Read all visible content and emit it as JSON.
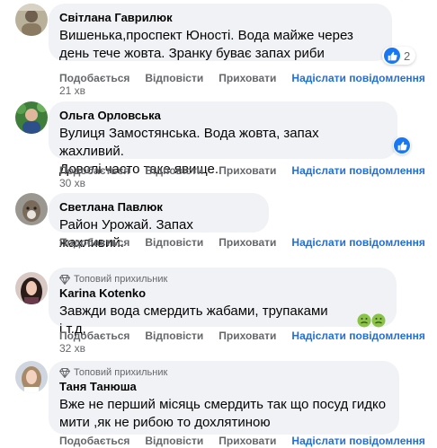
{
  "actions": {
    "like": "Подобається",
    "reply": "Відповісти",
    "hide": "Приховати",
    "send_message": "Надіслати повідомлення"
  },
  "comments": [
    {
      "author": "Світлана Гаврилюк",
      "text_lines": [
        "Вишенька,проспект Юності. Вода майже через",
        "день тече жовта. Зранку буває запах риби"
      ],
      "reactions": "2",
      "time": "21 хв"
    },
    {
      "author": "Ольга Орловська",
      "text_lines": [
        "Вулиця Замостянська. Вода жовта, запах жахливий.",
        "Доволі часто таке явище."
      ],
      "time": "30 хв"
    },
    {
      "author": "Светлана Павлюк",
      "text_lines": [
        "Район Урожай. Запах жахливий."
      ],
      "time": ""
    },
    {
      "badge": "Топовий прихильник",
      "author": "Karina Kotenko",
      "text_lines": [
        "Завжди вода смердить жабами, трупаками і.т.д,"
      ],
      "time": "32 хв"
    },
    {
      "badge": "Топовий прихильник",
      "author": "Таня Танюша",
      "text_lines": [
        "Вже не перший місяць смердить так що посуд гидко",
        "мити ,як не рибою то дохлятиною"
      ],
      "time": ""
    }
  ],
  "colors": {
    "bubble": "#f0f2f5",
    "link": "#216fdb",
    "meta": "#65676b",
    "like_blue": "#1877f2"
  }
}
